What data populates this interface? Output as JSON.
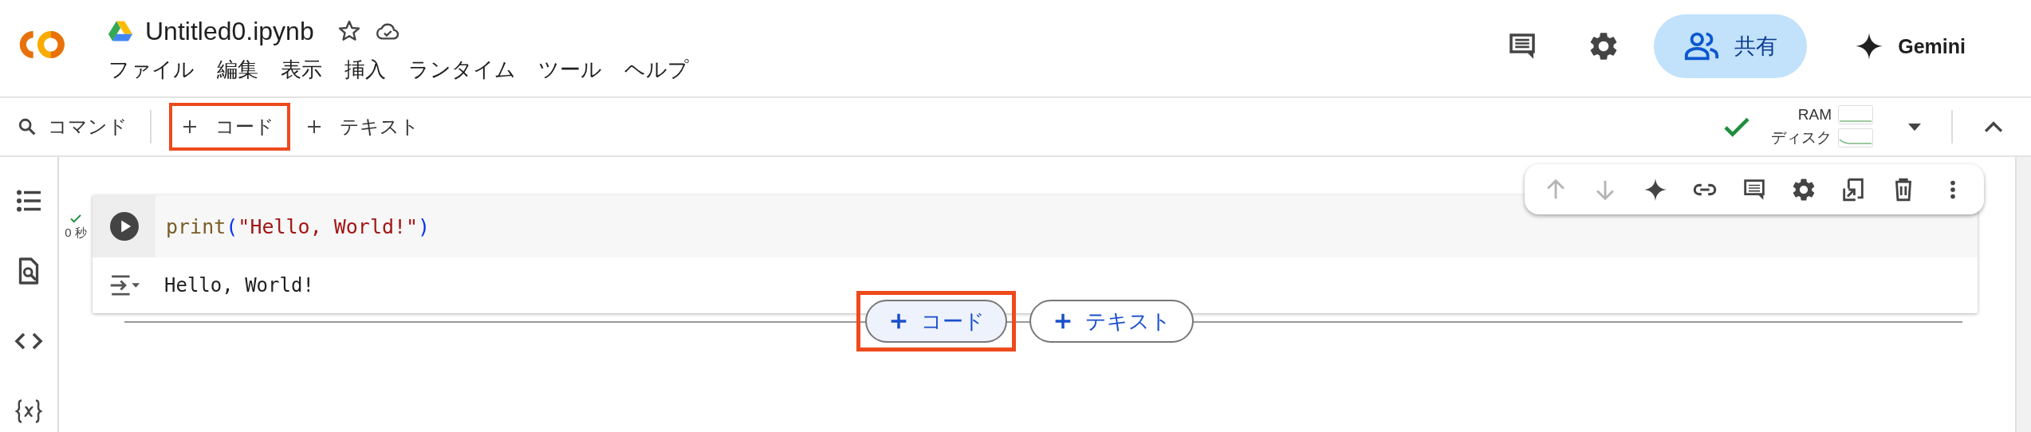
{
  "file": {
    "title": "Untitled0.ipynb",
    "starred": false
  },
  "menu": [
    {
      "label": "ファイル"
    },
    {
      "label": "編集"
    },
    {
      "label": "表示"
    },
    {
      "label": "挿入"
    },
    {
      "label": "ランタイム"
    },
    {
      "label": "ツール"
    },
    {
      "label": "ヘルプ"
    }
  ],
  "header_actions": {
    "share_label": "共有",
    "gemini_label": "Gemini"
  },
  "toolbar": {
    "command_label": "コマンド",
    "buttons": [
      {
        "label": "コード",
        "highlighted": true
      },
      {
        "label": "テキスト",
        "highlighted": false
      }
    ],
    "connected": true,
    "resources": [
      {
        "label": "RAM"
      },
      {
        "label": "ディスク"
      }
    ]
  },
  "cell": {
    "executed": true,
    "time": "0 秒",
    "code": [
      {
        "kind": "function",
        "text": "print"
      },
      {
        "kind": "paren",
        "text": "("
      },
      {
        "kind": "string",
        "text": "\"Hello, World!\""
      },
      {
        "kind": "paren",
        "text": ")"
      }
    ],
    "output": "Hello, World!"
  },
  "cell_toolbar": [
    {
      "kind": "move_up",
      "disabled": true
    },
    {
      "kind": "move_down",
      "disabled": true
    },
    {
      "kind": "gemini",
      "disabled": false
    },
    {
      "kind": "link",
      "disabled": false
    },
    {
      "kind": "comment",
      "disabled": false
    },
    {
      "kind": "settings",
      "disabled": false
    },
    {
      "kind": "mirror",
      "disabled": false
    },
    {
      "kind": "delete",
      "disabled": false
    },
    {
      "kind": "more",
      "disabled": false
    }
  ],
  "insert_buttons": [
    {
      "label": "コード",
      "highlighted": true
    },
    {
      "label": "テキスト",
      "highlighted": false
    }
  ]
}
